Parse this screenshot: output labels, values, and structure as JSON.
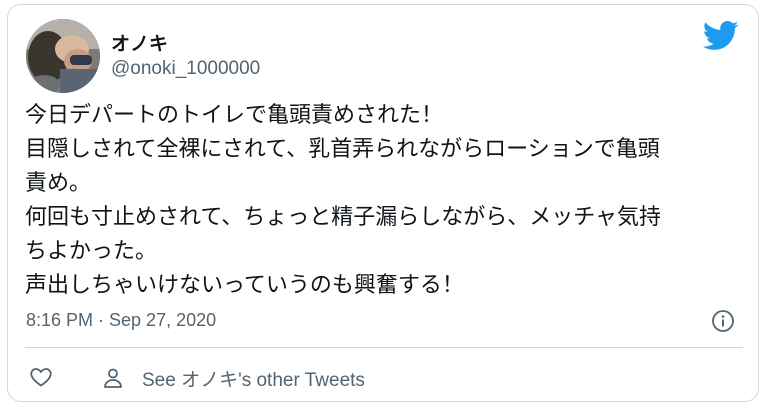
{
  "tweet": {
    "author_name": "オノキ",
    "author_handle": "@onoki_1000000",
    "lines": [
      "今日デパートのトイレで亀頭責めされた！",
      "目隠しされて全裸にされて、乳首弄られながらローションで亀頭",
      "責め。",
      "何回も寸止めされて、ちょっと精子漏らしながら、メッチャ気持",
      "ちよかった。",
      "声出しちゃいけないっていうのも興奮する！"
    ],
    "timestamp": "8:16 PM · Sep 27, 2020",
    "see_other_label": "See オノキ's other Tweets"
  },
  "icons": {
    "brand": "twitter-bird-icon",
    "info": "info-icon",
    "like": "heart-icon",
    "profile": "person-icon"
  },
  "colors": {
    "brand": "#1d9bf0",
    "text": "#0f1419",
    "secondary": "#536471",
    "border": "#cfd9de"
  }
}
